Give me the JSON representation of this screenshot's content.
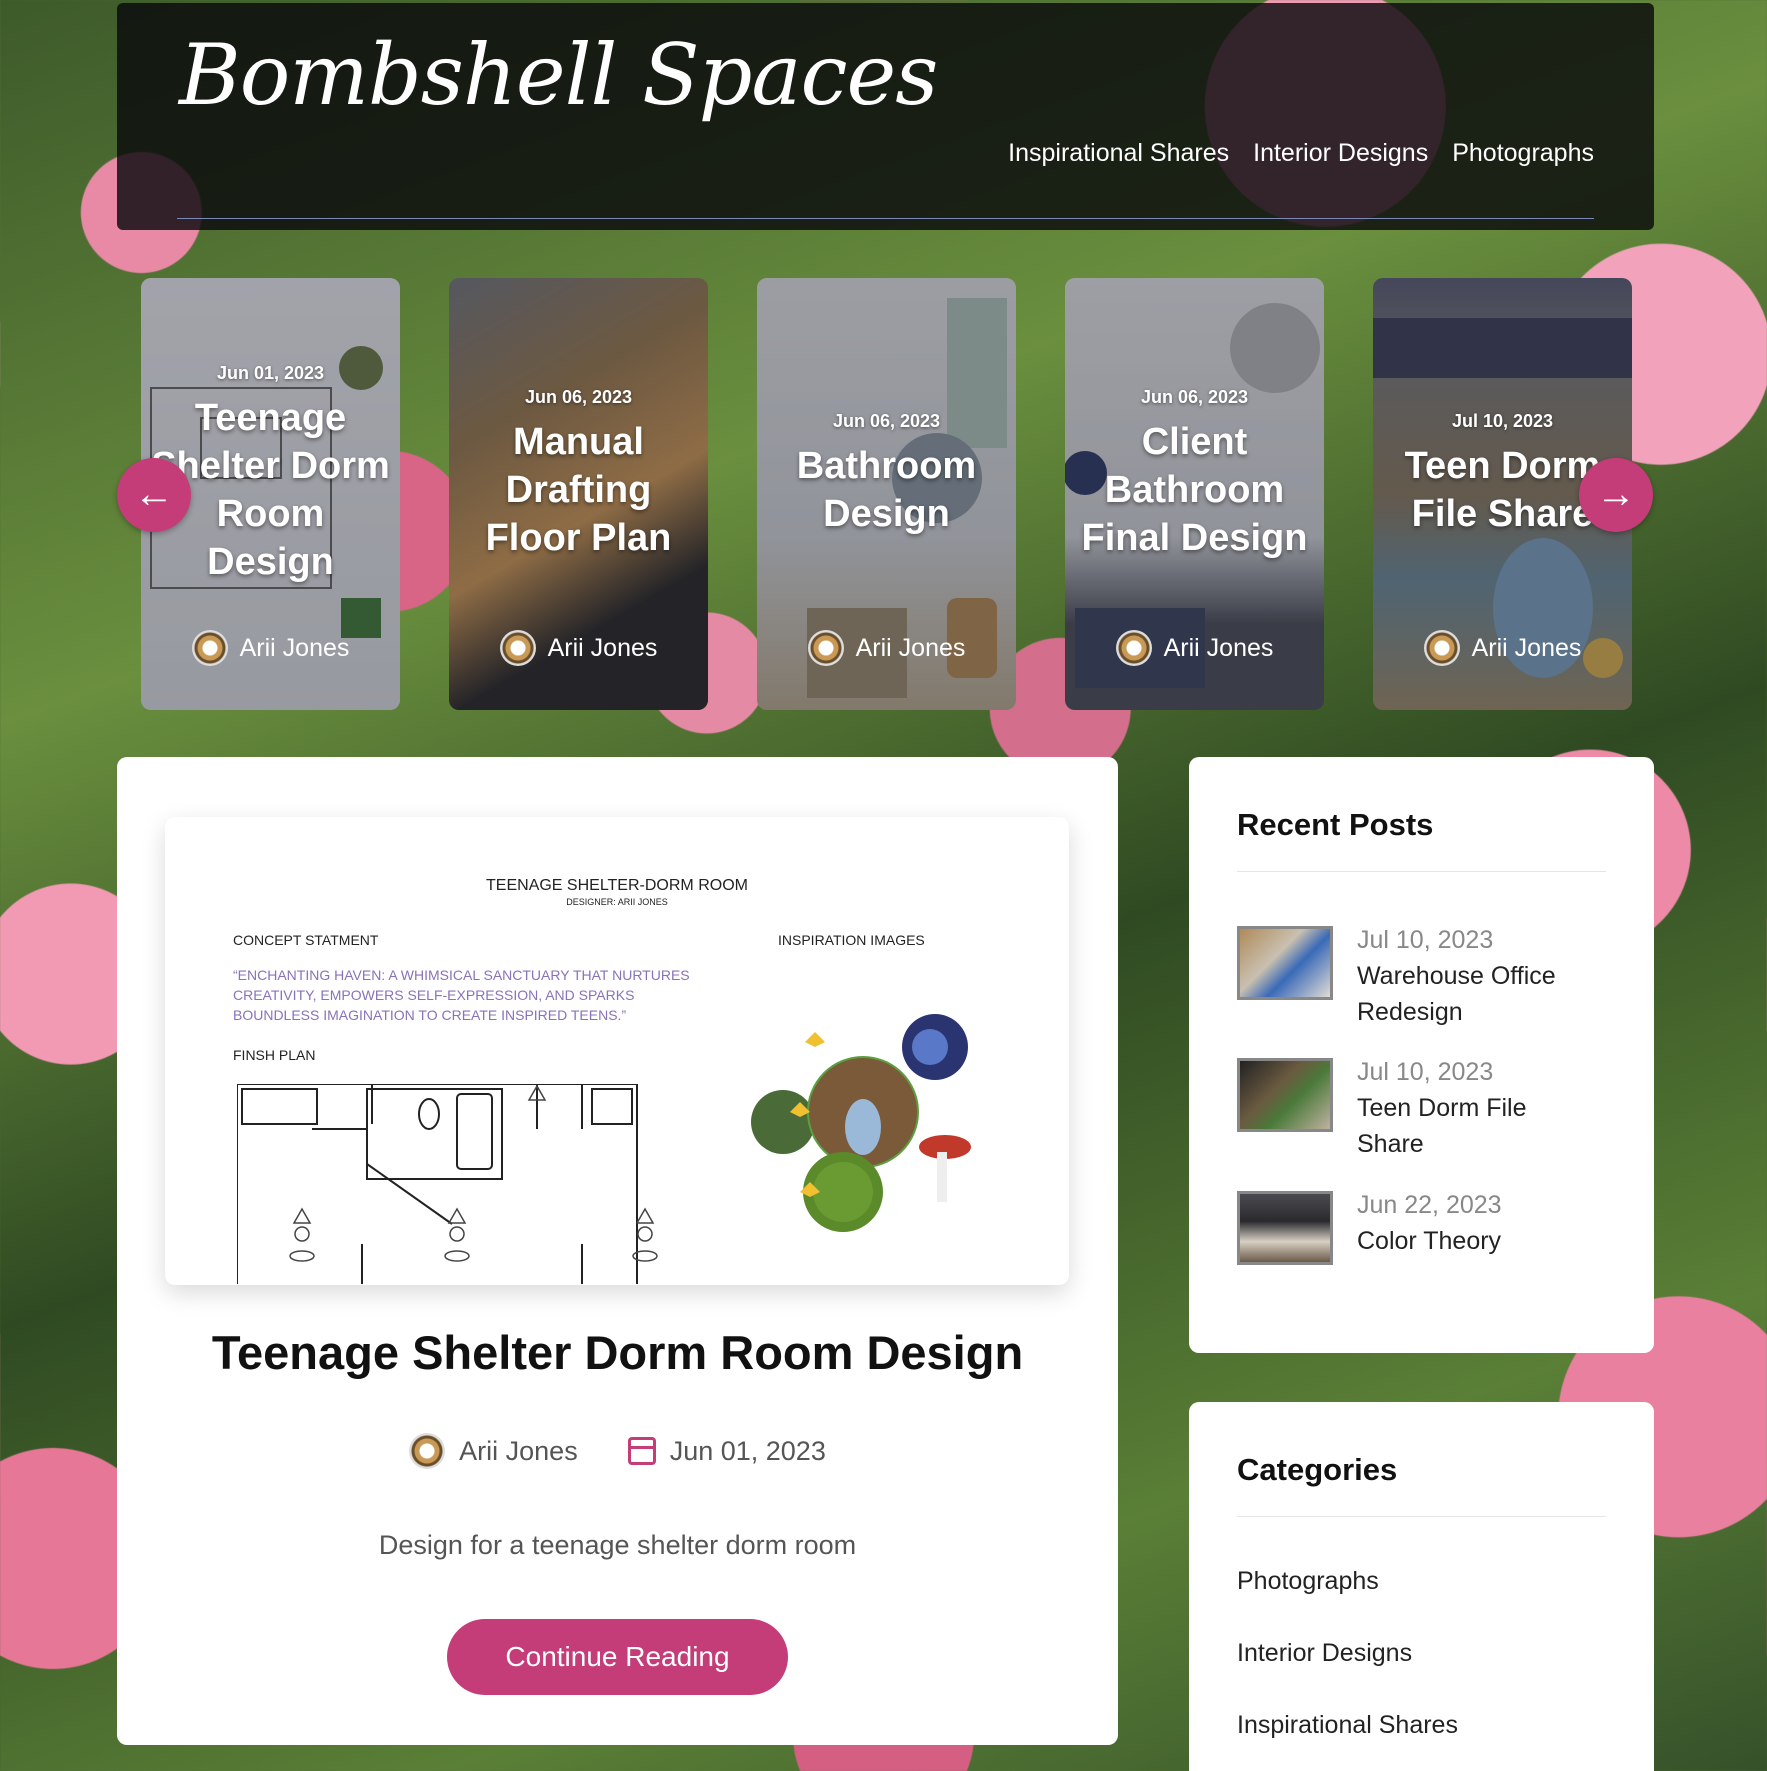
{
  "site": {
    "logo": "Bombshell Spaces",
    "nav": [
      "Inspirational Shares",
      "Interior Designs",
      "Photographs"
    ]
  },
  "carousel": {
    "cards": [
      {
        "date": "Jun 01, 2023",
        "title": "Teenage Shelter Dorm Room Design",
        "author": "Arii Jones"
      },
      {
        "date": "Jun 06, 2023",
        "title": "Manual Drafting Floor Plan",
        "author": "Arii Jones"
      },
      {
        "date": "Jun 06, 2023",
        "title": "Bathroom Design",
        "author": "Arii Jones"
      },
      {
        "date": "Jun 06, 2023",
        "title": "Client Bathroom Final Design",
        "author": "Arii Jones"
      },
      {
        "date": "Jul 10, 2023",
        "title": "Teen Dorm File Share",
        "author": "Arii Jones"
      }
    ],
    "prev_icon": "arrow-left-icon",
    "next_icon": "arrow-right-icon"
  },
  "featured_image": {
    "title": "TEENAGE SHELTER-DORM ROOM",
    "designer": "DESIGNER: ARII JONES",
    "concept_label": "CONCEPT STATMENT",
    "inspiration_label": "INSPIRATION IMAGES",
    "quote": "“ENCHANTING HAVEN: A WHIMSICAL SANCTUARY THAT NURTURES CREATIVITY, EMPOWERS SELF-EXPRESSION, AND SPARKS BOUNDLESS IMAGINATION TO CREATE INSPIRED TEENS.”",
    "plan_label": "FINSH PLAN"
  },
  "post": {
    "title": "Teenage Shelter Dorm Room Design",
    "author": "Arii Jones",
    "date": "Jun 01, 2023",
    "excerpt": "Design for a teenage shelter dorm room",
    "button": "Continue Reading"
  },
  "recent_posts": {
    "heading": "Recent Posts",
    "items": [
      {
        "date": "Jul 10, 2023",
        "title": "Warehouse Office Redesign"
      },
      {
        "date": "Jul 10, 2023",
        "title": "Teen Dorm File Share"
      },
      {
        "date": "Jun 22, 2023",
        "title": "Color Theory"
      }
    ]
  },
  "categories": {
    "heading": "Categories",
    "items": [
      "Photographs",
      "Interior Designs",
      "Inspirational Shares"
    ]
  },
  "colors": {
    "accent": "#c43c78",
    "header_bg": "#0a0a0c"
  }
}
